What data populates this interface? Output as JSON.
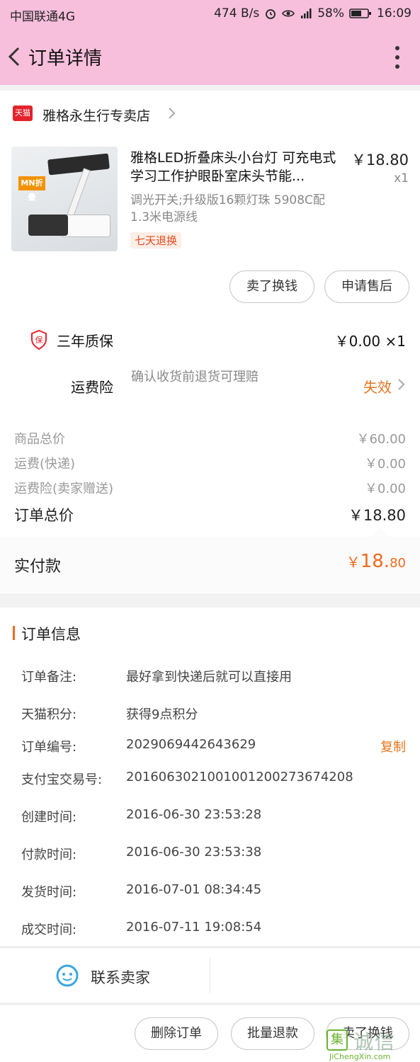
{
  "status_bar": {
    "carrier": "中国联通4G",
    "speed": "474 B/s",
    "battery": "58%",
    "time": "16:09"
  },
  "header": {
    "title": "订单详情"
  },
  "shop": {
    "badge": "天猫",
    "name": "雅格永生行专卖店"
  },
  "product": {
    "image_tag": "MN折叠",
    "title": "雅格LED折叠床头小台灯 可充电式学习工作护眼卧室床头节能...",
    "price": "￥18.80",
    "quantity": "x1",
    "spec": "调光开关;升级版16颗灯珠 5908C配1.3米电源线",
    "badge": "七天退换"
  },
  "item_actions": {
    "sell": "卖了换钱",
    "after_sale": "申请售后"
  },
  "warranty": {
    "icon_text": "保",
    "label": "三年质保",
    "value": "￥0.00 ×1"
  },
  "shipping_insurance": {
    "label": "运费险",
    "description": "确认收货前退货可理赔",
    "status": "失效"
  },
  "summary": [
    {
      "label": "商品总价",
      "value": "￥60.00"
    },
    {
      "label": "运费(快递)",
      "value": "￥0.00"
    },
    {
      "label": "运费险(卖家赠送)",
      "value": "￥0.00"
    }
  ],
  "total": {
    "label": "订单总价",
    "value": "￥18.80"
  },
  "paid": {
    "label": "实付款",
    "currency": "￥",
    "integer": "18.",
    "decimal": "80"
  },
  "order_info": {
    "heading": "订单信息",
    "copy_label": "复制",
    "rows": [
      {
        "key": "订单备注:",
        "value": "最好拿到快递后就可以直接用"
      },
      {
        "key": "天猫积分:",
        "value": "获得9点积分"
      },
      {
        "key": "订单编号:",
        "value": "2029069442643629"
      },
      {
        "key": "支付宝交易号:",
        "value": "2016063021001001200273674208"
      },
      {
        "key": "创建时间:",
        "value": "2016-06-30 23:53:28"
      },
      {
        "key": "付款时间:",
        "value": "2016-06-30 23:53:38"
      },
      {
        "key": "发货时间:",
        "value": "2016-07-01 08:34:45"
      },
      {
        "key": "成交时间:",
        "value": "2016-07-11 19:08:54"
      }
    ]
  },
  "contact": {
    "label": "联系卖家"
  },
  "footer_actions": {
    "delete": "删除订单",
    "batch_refund": "批量退款",
    "sell": "卖了换钱"
  },
  "watermark": {
    "glyph": "集",
    "text": "诚信",
    "url": "JiChengXin.com"
  },
  "colors": {
    "status_bg": "#f7bfdc",
    "accent": "#f26a21",
    "tmall_red": "#e4222c"
  }
}
